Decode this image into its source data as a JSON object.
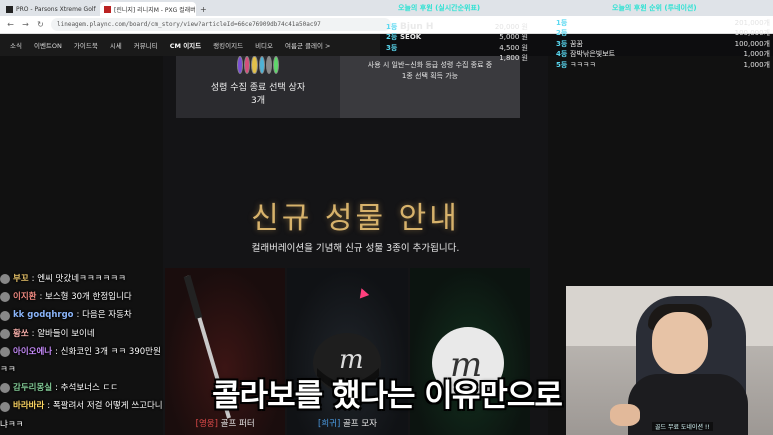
{
  "browser": {
    "tabs": [
      {
        "title": "PRO - Parsons Xtreme Golf",
        "active": false
      },
      {
        "title": "[린니지] 리니지M - PXG 컬래버",
        "active": true
      }
    ],
    "new_tab": "+",
    "url": "lineagem.plaync.com/board/cm_story/view?articleId=66ce76909db74c41a50ac97"
  },
  "site_nav": {
    "items": [
      "소식",
      "이벤트ON",
      "가이드북",
      "시세",
      "커뮤니티",
      "CM 이지드",
      "랭킹이지드",
      "비디오",
      "여름군 클레이 >"
    ]
  },
  "top_cards": {
    "left_title_line1": "성령 수집 종료 선택 상자",
    "left_title_line2": "3개",
    "right_text_line1": "사용 시 일반~신화 등급 성령 수집 종료 중",
    "right_text_line2": "1종 선택 획득 가능"
  },
  "main": {
    "title": "신규 성물 안내",
    "subtitle": "컬래버레이션을 기념해 신규 성물 3종이 추가됩니다."
  },
  "items": [
    {
      "grade": "[영웅]",
      "name": "골프 퍼터"
    },
    {
      "grade": "[희귀]",
      "name": "골프 모자"
    },
    {
      "grade": "",
      "name": ""
    }
  ],
  "overlay_left": {
    "header": "오늘의 후원 (실시간순위표)",
    "rows": [
      {
        "rank": "1등",
        "name": "Bjun H",
        "amount": "20,000 원"
      },
      {
        "rank": "2등",
        "name": "SEOK",
        "amount": "5,000 원"
      },
      {
        "rank": "3등",
        "name": "",
        "amount": "4,500 원"
      },
      {
        "rank": "",
        "name": "",
        "amount": "1,800 원"
      }
    ]
  },
  "overlay_right": {
    "header": "오늘의 후원 순위 (투네이션)",
    "rows": [
      {
        "rank": "1등",
        "name": "",
        "amount": "201,000개"
      },
      {
        "rank": "2등",
        "name": "",
        "amount": "100,000개"
      },
      {
        "rank": "3등",
        "name": "꿈꿈",
        "amount": "100,000개"
      },
      {
        "rank": "4등",
        "name": "잠박낚은빛보트",
        "amount": "1,000개"
      },
      {
        "rank": "5등",
        "name": "ㅋㅋㅋㅋ",
        "amount": "1,000개"
      }
    ]
  },
  "chat": [
    {
      "user": "부꼬",
      "msg": ": 엔씨 맛갔네ㅋㅋㅋㅋㅋㅋ",
      "color": "#e9c46a"
    },
    {
      "user": "이지환",
      "msg": ": 보스형 30개 한정입니다",
      "color": "#f28b82"
    },
    {
      "user": "kk godqhrgo",
      "msg": ": 다음은 자동차",
      "color": "#8ab4f8"
    },
    {
      "user": "황쏘",
      "msg": ": 알바들이 보이네",
      "color": "#f6aea9"
    },
    {
      "user": "아이오에나",
      "msg": ": 신화코인 3개 ㅋㅋ 390만원",
      "color": "#c58af9"
    },
    {
      "user": "",
      "msg": "ㅋㅋ",
      "color": "#ffffff"
    },
    {
      "user": "감두리몽실",
      "msg": ": 추석보너스 ㄷㄷ",
      "color": "#81c995"
    },
    {
      "user": "바라바라",
      "msg": ": 폭팔려서 저걸 어떻게 쓰고다니",
      "color": "#fdd663"
    },
    {
      "user": "",
      "msg": "냐ㅋㅋ",
      "color": "#ffffff"
    }
  ],
  "webcam": {
    "tag": "골드 무료 도네이션 !!"
  },
  "caption": "콜라보를 했다는 이유만으로"
}
